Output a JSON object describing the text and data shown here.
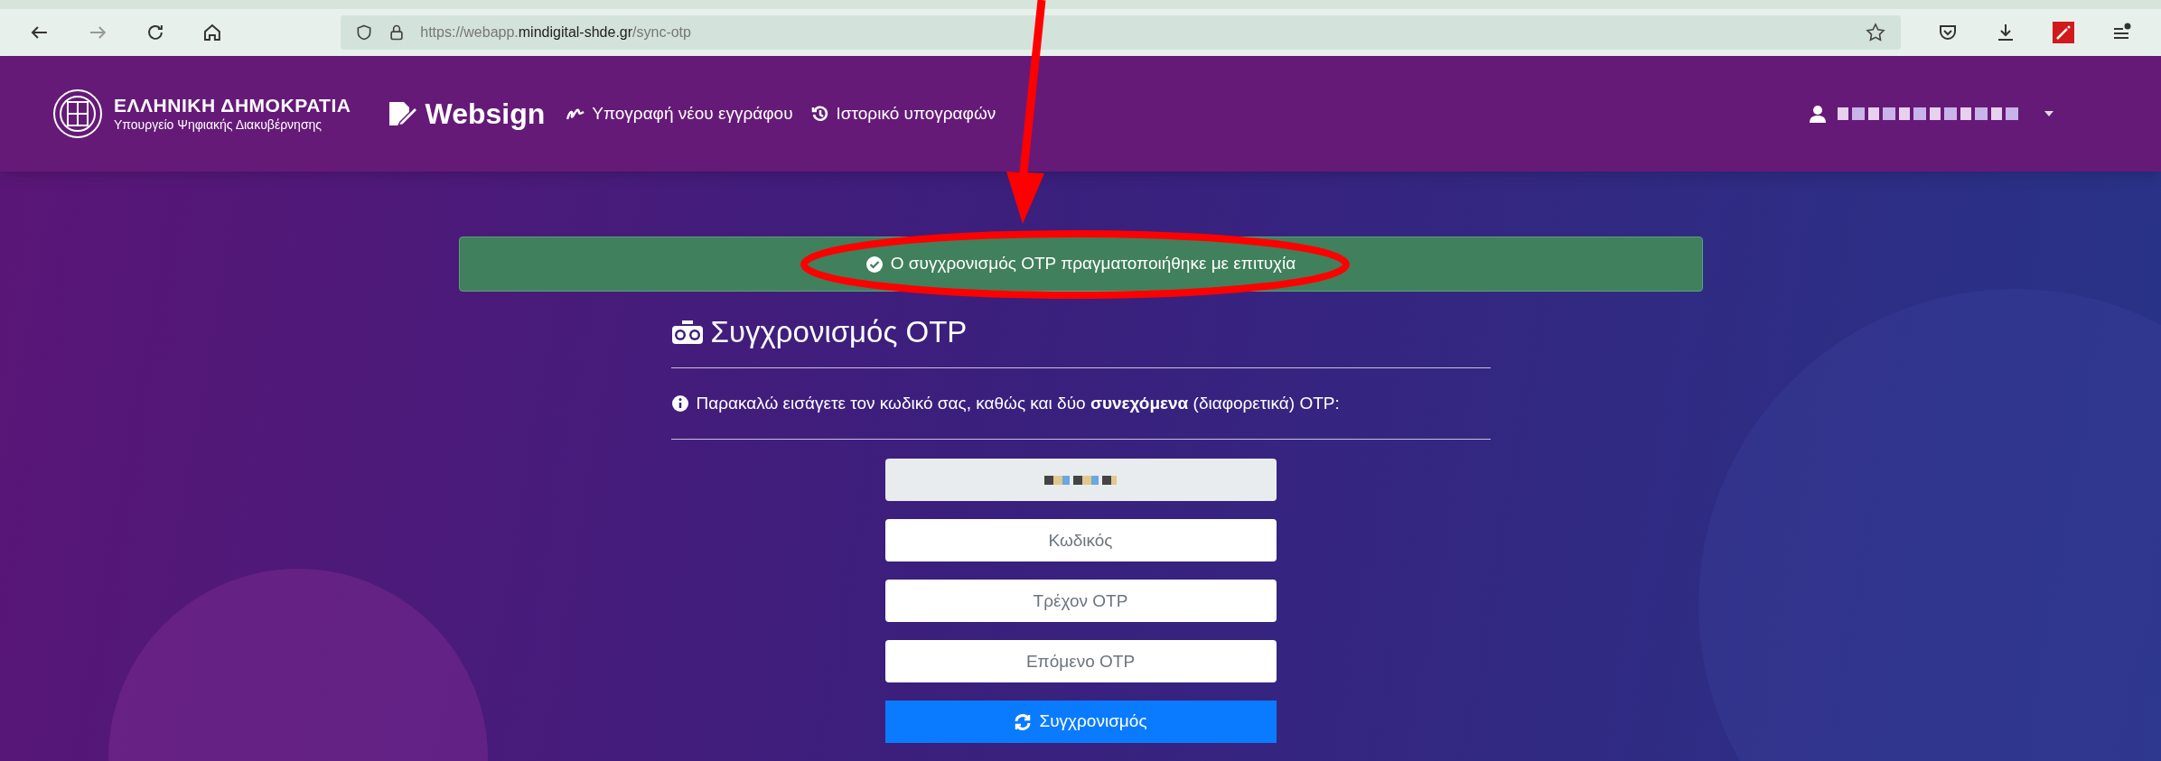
{
  "browser": {
    "url_prefix": "https://webapp.",
    "url_domain": "mindigital-shde.gr",
    "url_path": "/sync-otp"
  },
  "header": {
    "org_title": "ΕΛΛΗΝΙΚΗ ΔΗΜΟΚΡΑΤΙΑ",
    "org_subtitle": "Υπουργείο Ψηφιακής Διακυβέρνησης",
    "brand": "Websign",
    "nav": [
      {
        "label": "Υπογραφή νέου εγγράφου",
        "kind": "signature"
      },
      {
        "label": "Ιστορικό υπογραφών",
        "kind": "history"
      }
    ],
    "user": {
      "redacted": true
    }
  },
  "alert": {
    "kind": "success",
    "text": "Ο συγχρονισμός OTP πραγματοποιήθηκε με επιτυχία"
  },
  "form": {
    "title": "Συγχρονισμός OTP",
    "info": "Παρακαλώ εισάγετε τον κωδικό σας, καθώς και δύο **συνεχόμενα** (διαφορετικά) OTP:",
    "fields": [
      {
        "kind": "redacted",
        "disabled": true
      },
      {
        "kind": "input",
        "placeholder": "Κωδικός",
        "disabled": false
      },
      {
        "kind": "input",
        "placeholder": "Τρέχον OTP",
        "disabled": false
      },
      {
        "kind": "input",
        "placeholder": "Επόμενο OTP",
        "disabled": false
      }
    ],
    "button": "Συγχρονισμός"
  }
}
